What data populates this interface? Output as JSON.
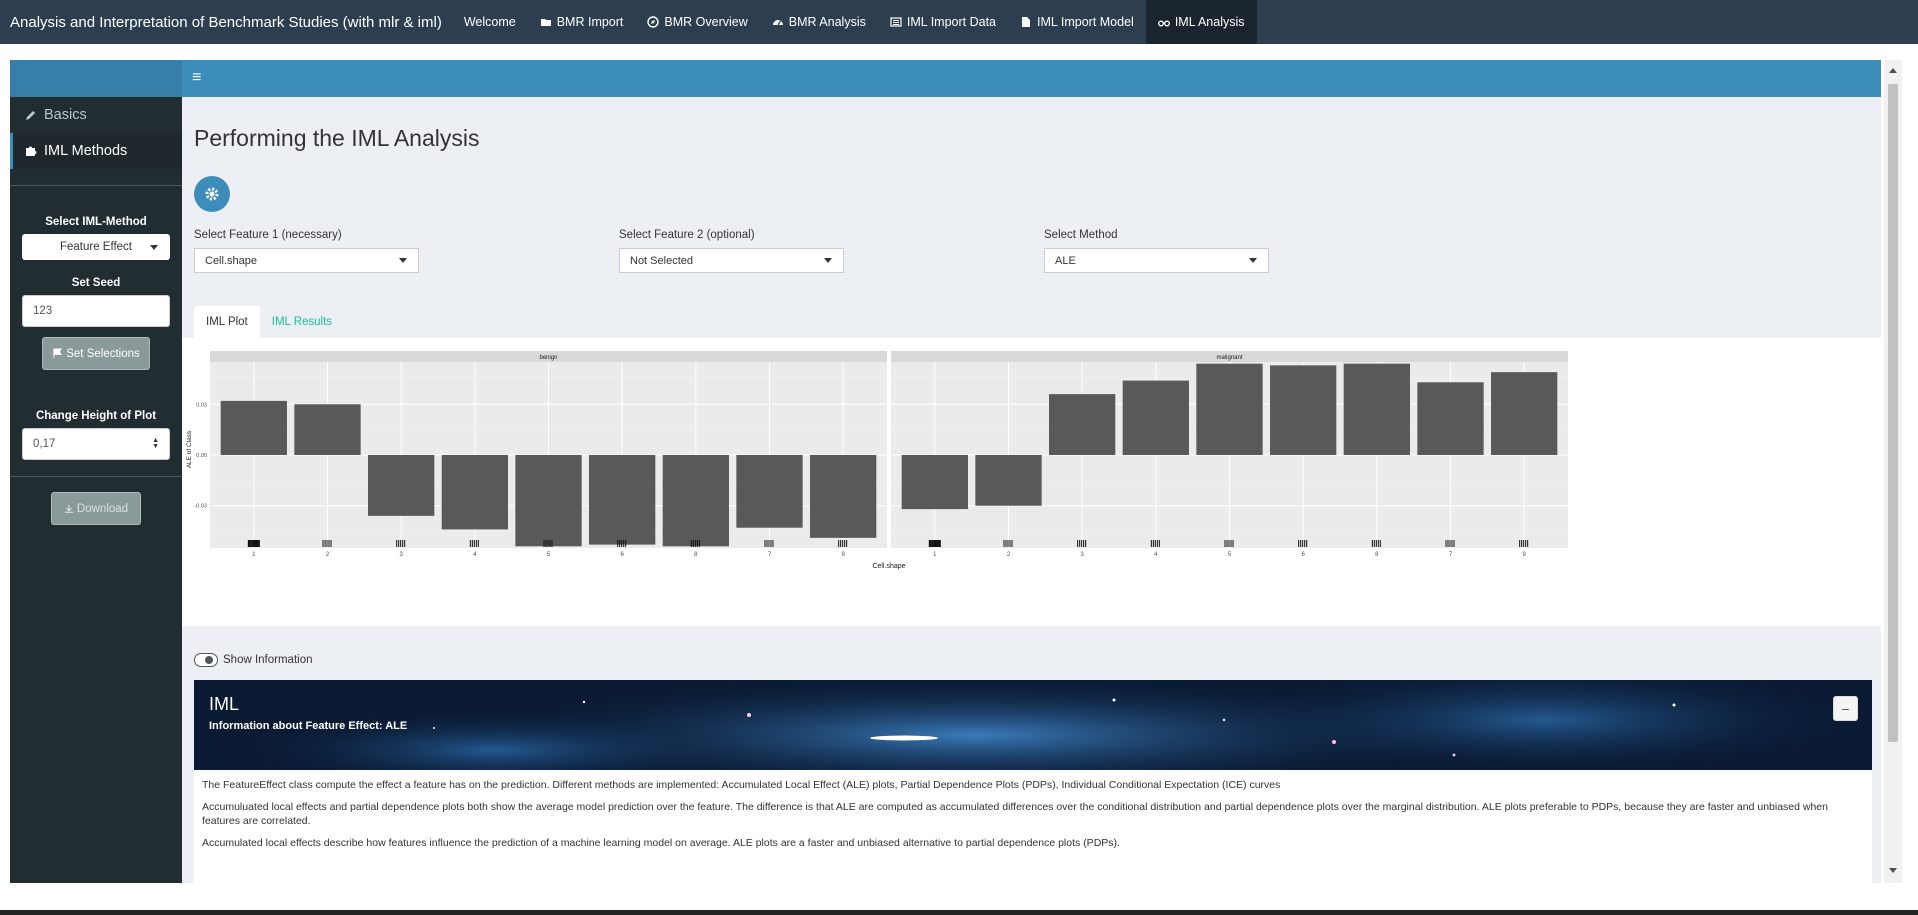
{
  "app_title": "Analysis and Interpretation of Benchmark Studies (with mlr & iml)",
  "nav_tabs": [
    {
      "label": "Welcome",
      "icon": "none"
    },
    {
      "label": "BMR Import",
      "icon": "folder-open-icon"
    },
    {
      "label": "BMR Overview",
      "icon": "compass-icon"
    },
    {
      "label": "BMR Analysis",
      "icon": "tachometer-icon"
    },
    {
      "label": "IML Import Data",
      "icon": "list-icon"
    },
    {
      "label": "IML Import Model",
      "icon": "file-icon"
    },
    {
      "label": "IML Analysis",
      "icon": "binoculars-icon"
    }
  ],
  "active_nav_tab": "IML Analysis",
  "sidebar": {
    "items": [
      {
        "label": "Basics",
        "icon": "pencil-icon"
      },
      {
        "label": "IML Methods",
        "icon": "puzzle-icon"
      }
    ],
    "select_method_label": "Select IML-Method",
    "select_method_value": "Feature Effect",
    "seed_label": "Set Seed",
    "seed_value": "123",
    "set_selections_label": "Set Selections",
    "height_label": "Change Height of Plot",
    "height_value": "0,17",
    "download_label": "Download"
  },
  "main": {
    "title": "Performing the IML Analysis",
    "feature1_label": "Select Feature 1 (necessary)",
    "feature1_value": "Cell.shape",
    "feature2_label": "Select Feature 2 (optional)",
    "feature2_value": "Not Selected",
    "method_label": "Select Method",
    "method_value": "ALE",
    "tabs": [
      {
        "label": "IML Plot"
      },
      {
        "label": "IML Results"
      }
    ],
    "active_tab": "IML Plot",
    "show_info_label": "Show Information"
  },
  "info": {
    "title": "IML",
    "subtitle": "Information about Feature Effect: ALE",
    "paragraphs": [
      "The FeatureEffect class compute the effect a feature has on the prediction. Different methods are implemented: Accumulated Local Effect (ALE) plots, Partial Dependence Plots (PDPs), Individual Conditional Expectation (ICE) curves",
      "Accumuluated local effects and partial dependence plots both show the average model prediction over the feature. The difference is that ALE are computed as accumulated differences over the conditional distribution and partial dependence plots over the marginal distribution. ALE plots preferable to PDPs, because they are faster and unbiased when features are correlated.",
      "Accumulated local effects describe how features influence the prediction of a machine learning model on average. ALE plots are a faster and unbiased alternative to partial dependence plots (PDPs)."
    ]
  },
  "colors": {
    "navbar": "#2c3e50",
    "header": "#3c8dbc",
    "sidebar": "#222d32",
    "bar": "#595959",
    "panel": "#ebebeb",
    "link": "#18bc9c"
  },
  "chart_data": {
    "type": "bar",
    "xlabel": "Cell.shape",
    "ylabel": "ALE of Class",
    "ylim": [
      -0.055,
      0.055
    ],
    "yticks": [
      -0.03,
      0.0,
      0.03
    ],
    "ytick_labels": [
      "-0.03",
      "0.00",
      "0.03"
    ],
    "categories": [
      "1",
      "2",
      "3",
      "4",
      "5",
      "6",
      "8",
      "7",
      "9"
    ],
    "panels": [
      {
        "name": "benign",
        "values": [
          0.032,
          0.03,
          -0.036,
          -0.044,
          -0.054,
          -0.053,
          -0.054,
          -0.043,
          -0.049
        ]
      },
      {
        "name": "malignant",
        "values": [
          -0.032,
          -0.03,
          0.036,
          0.044,
          0.054,
          0.053,
          0.054,
          0.043,
          0.049
        ]
      }
    ],
    "grid": true,
    "rug": true
  }
}
